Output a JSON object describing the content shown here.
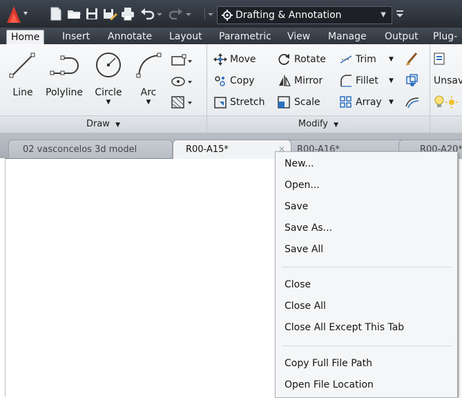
{
  "quick_access": {
    "workspace": "Drafting & Annotation",
    "icons": [
      "autocad-logo-icon",
      "new-file-icon",
      "open-file-icon",
      "save-icon",
      "save-as-icon",
      "print-icon",
      "undo-icon",
      "redo-icon",
      "workspace-gear-icon"
    ]
  },
  "ribbon_tabs": [
    "Home",
    "Insert",
    "Annotate",
    "Layout",
    "Parametric",
    "View",
    "Manage",
    "Output",
    "Plug-"
  ],
  "active_tab": "Home",
  "draw_panel": {
    "title": "Draw",
    "tools": [
      "Line",
      "Polyline",
      "Circle",
      "Arc"
    ]
  },
  "modify_panel": {
    "title": "Modify",
    "items": [
      "Move",
      "Rotate",
      "Trim",
      "Copy",
      "Mirror",
      "Fillet",
      "Stretch",
      "Scale",
      "Array"
    ]
  },
  "layers_panel": {
    "label": "Unsav"
  },
  "document_tabs": [
    "02 vasconcelos 3d model",
    "R00-A15*",
    "R00-A16*",
    "R00-A20*"
  ],
  "active_document": "R00-A15*",
  "context_menu": {
    "group1": [
      "New...",
      "Open...",
      "Save",
      "Save As...",
      "Save All"
    ],
    "group2": [
      "Close",
      "Close All",
      "Close All Except This Tab"
    ],
    "group3": [
      "Copy Full File Path",
      "Open File Location"
    ]
  },
  "colors": {
    "accent": "#c9312b",
    "qat_bg": "#2f353c",
    "ribbon_bg": "#eef0f2",
    "icon_blue": "#2a6fbf"
  }
}
